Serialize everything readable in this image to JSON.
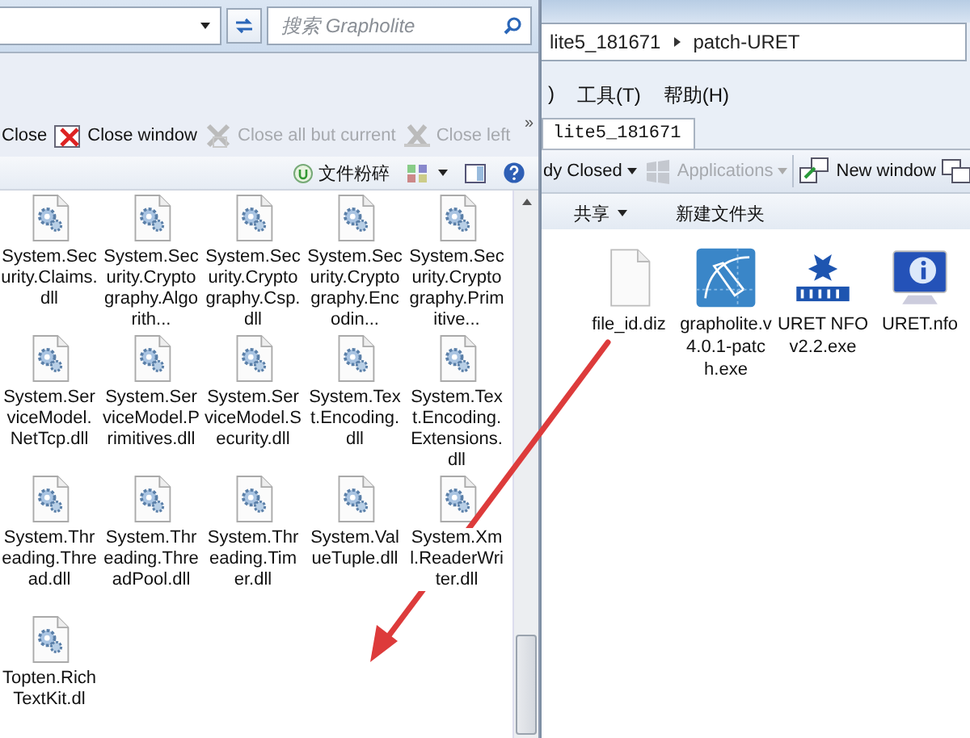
{
  "front_window": {
    "search": {
      "placeholder": "搜索 Grapholite"
    },
    "toolbar": [
      {
        "kind": "close",
        "label": "Close",
        "disabled": false
      },
      {
        "kind": "window",
        "label": "Close window",
        "disabled": false
      },
      {
        "kind": "others",
        "label": "Close all but current",
        "disabled": true
      },
      {
        "kind": "left",
        "label": "Close left",
        "disabled": true
      }
    ],
    "overflow": "»",
    "command": "文件粉碎",
    "files": [
      {
        "kind": "dll",
        "name": "System.Security.Claims.dll"
      },
      {
        "kind": "dll",
        "name": "System.Security.Cryptography.Algorith..."
      },
      {
        "kind": "dll",
        "name": "System.Security.Cryptography.Csp.dll"
      },
      {
        "kind": "dll",
        "name": "System.Security.Cryptography.Encodin..."
      },
      {
        "kind": "dll",
        "name": "System.Security.Cryptography.Primitive..."
      },
      {
        "kind": "dll",
        "name": "System.ServiceModel.NetTcp.dll"
      },
      {
        "kind": "dll",
        "name": "System.ServiceModel.Primitives.dll"
      },
      {
        "kind": "dll",
        "name": "System.ServiceModel.Security.dll"
      },
      {
        "kind": "dll",
        "name": "System.Text.Encoding.dll"
      },
      {
        "kind": "dll",
        "name": "System.Text.Encoding.Extensions.dll"
      },
      {
        "kind": "dll",
        "name": "System.Threading.Thread.dll"
      },
      {
        "kind": "dll",
        "name": "System.Threading.ThreadPool.dll"
      },
      {
        "kind": "dll",
        "name": "System.Threading.Timer.dll"
      },
      {
        "kind": "dll",
        "name": "System.ValueTuple.dll"
      },
      {
        "kind": "dll",
        "name": "System.Xml.ReaderWriter.dll"
      },
      {
        "kind": "dll",
        "name": "Topten.RichTextKit.dl"
      }
    ]
  },
  "back_window": {
    "breadcrumb": [
      "lite5_181671",
      "patch-URET"
    ],
    "menu": [
      ")",
      "工具(T)",
      "帮助(H)"
    ],
    "tabs": [
      {
        "label": "lite5_181671",
        "selected": true
      }
    ],
    "toolbar": [
      {
        "kind": "recent",
        "label": "dy Closed",
        "disabled": false,
        "dropdown": true
      },
      {
        "kind": "apps",
        "label": "Applications",
        "disabled": true,
        "dropdown": true
      },
      {
        "kind": "newwin",
        "label": "New window",
        "disabled": false,
        "dropdown": false
      }
    ],
    "commands": [
      {
        "label": "共享",
        "dropdown": true
      },
      {
        "label": "新建文件夹",
        "dropdown": false
      }
    ],
    "files": [
      {
        "kind": "text",
        "name": "file_id.diz"
      },
      {
        "kind": "drawapp",
        "name": "grapholite.v4.0.1-patch.exe"
      },
      {
        "kind": "uret",
        "name": "URET NFO v2.2.exe"
      },
      {
        "kind": "nfo",
        "name": "URET.nfo"
      }
    ]
  }
}
